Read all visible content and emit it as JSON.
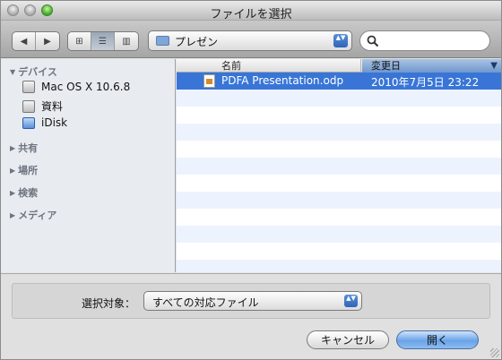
{
  "window": {
    "title": "ファイルを選択"
  },
  "toolbar": {
    "back_glyph": "◀",
    "forward_glyph": "▶",
    "view_icon_glyph": "⊞",
    "view_list_glyph": "☰",
    "view_column_glyph": "▥",
    "location": "プレゼン",
    "popup_arrows": "▲▼",
    "search_placeholder": ""
  },
  "sidebar": {
    "sections": [
      {
        "label": "デバイス",
        "expanded": true
      },
      {
        "label": "共有",
        "expanded": false
      },
      {
        "label": "場所",
        "expanded": false
      },
      {
        "label": "検索",
        "expanded": false
      },
      {
        "label": "メディア",
        "expanded": false
      }
    ],
    "devices": [
      {
        "label": "Mac OS X 10.6.8",
        "icon": "hard-disk-icon"
      },
      {
        "label": "資料",
        "icon": "hard-disk-icon"
      },
      {
        "label": "iDisk",
        "icon": "idisk-icon"
      }
    ],
    "tri_open": "▼",
    "tri_closed": "▶"
  },
  "filelist": {
    "columns": {
      "name": "名前",
      "date": "変更日"
    },
    "sort_arrow": "▼",
    "files": [
      {
        "name": "PDFA Presentation.odp",
        "modified": "2010年7月5日 23:22",
        "selected": true
      }
    ]
  },
  "bottom": {
    "enable_label": "選択対象：",
    "filter_value": "すべての対応ファイル",
    "cancel_label": "キャンセル",
    "open_label": "開く"
  },
  "colors": {
    "selection": "#3875d7",
    "accent": "#6aa3e8"
  }
}
